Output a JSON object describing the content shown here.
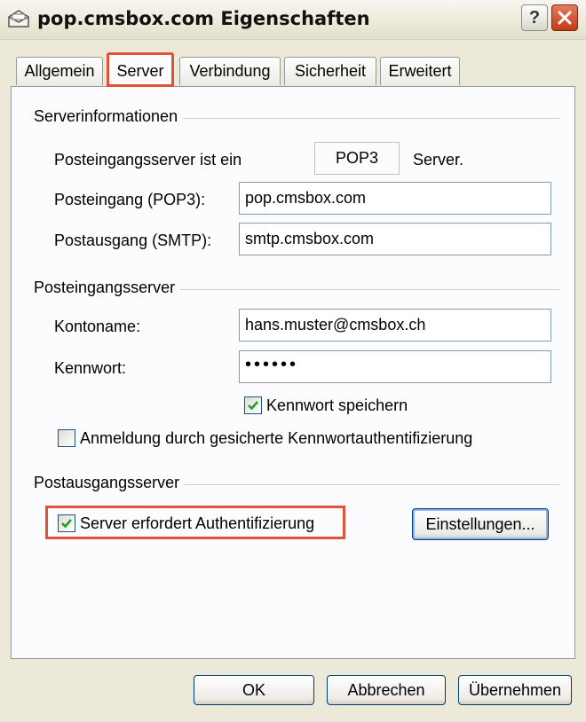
{
  "window": {
    "title": "pop.cmsbox.com Eigenschaften",
    "help_label": "?",
    "colors": {
      "accent": "#e0523a",
      "close": "#c23a17",
      "tab_highlight": "#f2b247"
    }
  },
  "tabs": [
    {
      "label": "Allgemein",
      "active": false
    },
    {
      "label": "Server",
      "active": true
    },
    {
      "label": "Verbindung",
      "active": false
    },
    {
      "label": "Sicherheit",
      "active": false
    },
    {
      "label": "Erweitert",
      "active": false
    }
  ],
  "server_info": {
    "heading": "Serverinformationen",
    "incoming_type_label": "Posteingangsserver ist ein",
    "incoming_type_value": "POP3",
    "incoming_type_suffix": "Server.",
    "incoming_label": "Posteingang (POP3):",
    "incoming_value": "pop.cmsbox.com",
    "outgoing_label": "Postausgang (SMTP):",
    "outgoing_value": "smtp.cmsbox.com"
  },
  "incoming_server": {
    "heading": "Posteingangsserver",
    "account_label": "Kontoname:",
    "account_value": "hans.muster@cmsbox.ch",
    "password_label": "Kennwort:",
    "password_value": "••••••",
    "remember_password_label": "Kennwort speichern",
    "remember_password_checked": true,
    "spa_label": "Anmeldung durch gesicherte Kennwortauthentifizierung",
    "spa_checked": false
  },
  "outgoing_server": {
    "heading": "Postausgangsserver",
    "auth_required_label": "Server erfordert Authentifizierung",
    "auth_required_checked": true,
    "settings_button": "Einstellungen..."
  },
  "footer": {
    "ok": "OK",
    "cancel": "Abbrechen",
    "apply": "Übernehmen"
  }
}
